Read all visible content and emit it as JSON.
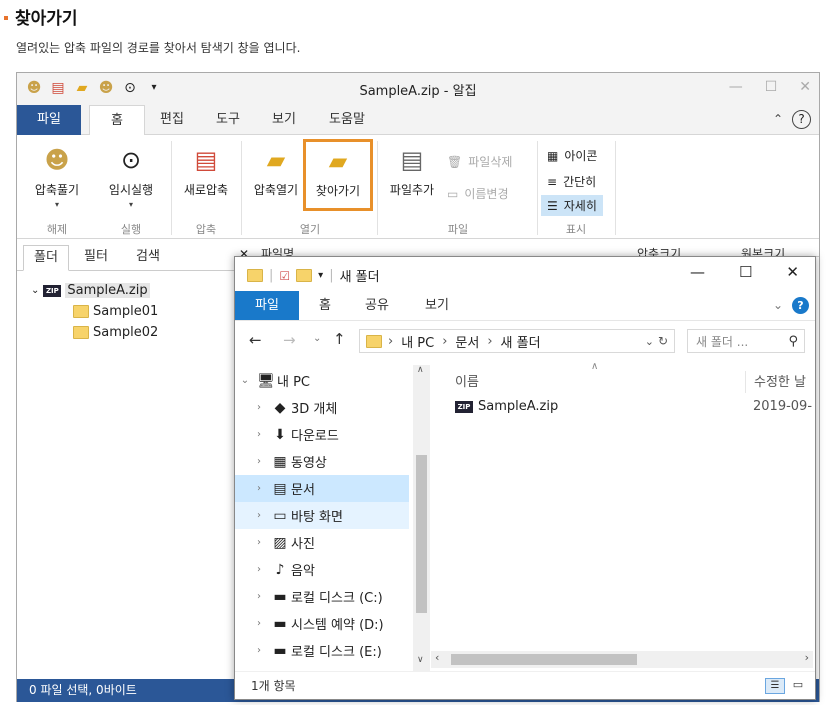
{
  "doc": {
    "title": "찾아가기",
    "description": "열려있는 압축 파일의 경로를 찾아서 탐색기 창을 엽니다."
  },
  "alzip": {
    "window_title": "SampleA.zip - 알집",
    "menu": [
      "파일",
      "홈",
      "편집",
      "도구",
      "보기",
      "도움말"
    ],
    "ribbon": {
      "unzip": "압축풀기",
      "temp_run": "임시실행",
      "new_zip": "새로압축",
      "open_zip": "압축열기",
      "goto": "찾아가기",
      "add_file": "파일추가",
      "delete_file": "파일삭제",
      "rename": "이름변경",
      "view_icon": "아이콘",
      "view_simple": "간단히",
      "view_detail": "자세히",
      "groups": {
        "extract": "해제",
        "run": "실행",
        "compress": "압축",
        "open": "열기",
        "file": "파일",
        "display": "표시"
      }
    },
    "left_tabs": [
      "폴더",
      "필터",
      "검색"
    ],
    "tree": {
      "root": "SampleA.zip",
      "children": [
        "Sample01",
        "Sample02"
      ]
    },
    "list_headers": [
      "파일명",
      "압축크기",
      "원본크기"
    ],
    "status": "0 파일 선택,  0바이트"
  },
  "explorer": {
    "title": "새 폴더",
    "tabs": [
      "파일",
      "홈",
      "공유",
      "보기"
    ],
    "address": [
      "내 PC",
      "문서",
      "새 폴더"
    ],
    "search_placeholder": "새 폴더 ...",
    "nav": [
      {
        "label": "내 PC",
        "icon": "monitor-icon",
        "glyph": "🖥"
      },
      {
        "label": "3D 개체",
        "icon": "cube-icon",
        "glyph": "◆"
      },
      {
        "label": "다운로드",
        "icon": "download-icon",
        "glyph": "⬇"
      },
      {
        "label": "동영상",
        "icon": "film-icon",
        "glyph": "▦"
      },
      {
        "label": "문서",
        "icon": "document-icon",
        "glyph": "▤"
      },
      {
        "label": "바탕 화면",
        "icon": "desktop-icon",
        "glyph": "▭"
      },
      {
        "label": "사진",
        "icon": "picture-icon",
        "glyph": "▨"
      },
      {
        "label": "음악",
        "icon": "music-icon",
        "glyph": "♪"
      },
      {
        "label": "로컬 디스크 (C:)",
        "icon": "drive-icon",
        "glyph": "▬"
      },
      {
        "label": "시스템 예약 (D:)",
        "icon": "drive-icon",
        "glyph": "▬"
      },
      {
        "label": "로컬 디스크 (E:)",
        "icon": "drive-icon",
        "glyph": "▬"
      }
    ],
    "columns": [
      "이름",
      "수정한 날"
    ],
    "files": [
      {
        "name": "SampleA.zip",
        "modified": "2019-09-"
      }
    ],
    "status": "1개 항목"
  },
  "colors": {
    "accent_orange": "#e8902a",
    "alzip_blue": "#2b5797",
    "explorer_blue": "#1979ca",
    "selection": "#cce8ff"
  }
}
